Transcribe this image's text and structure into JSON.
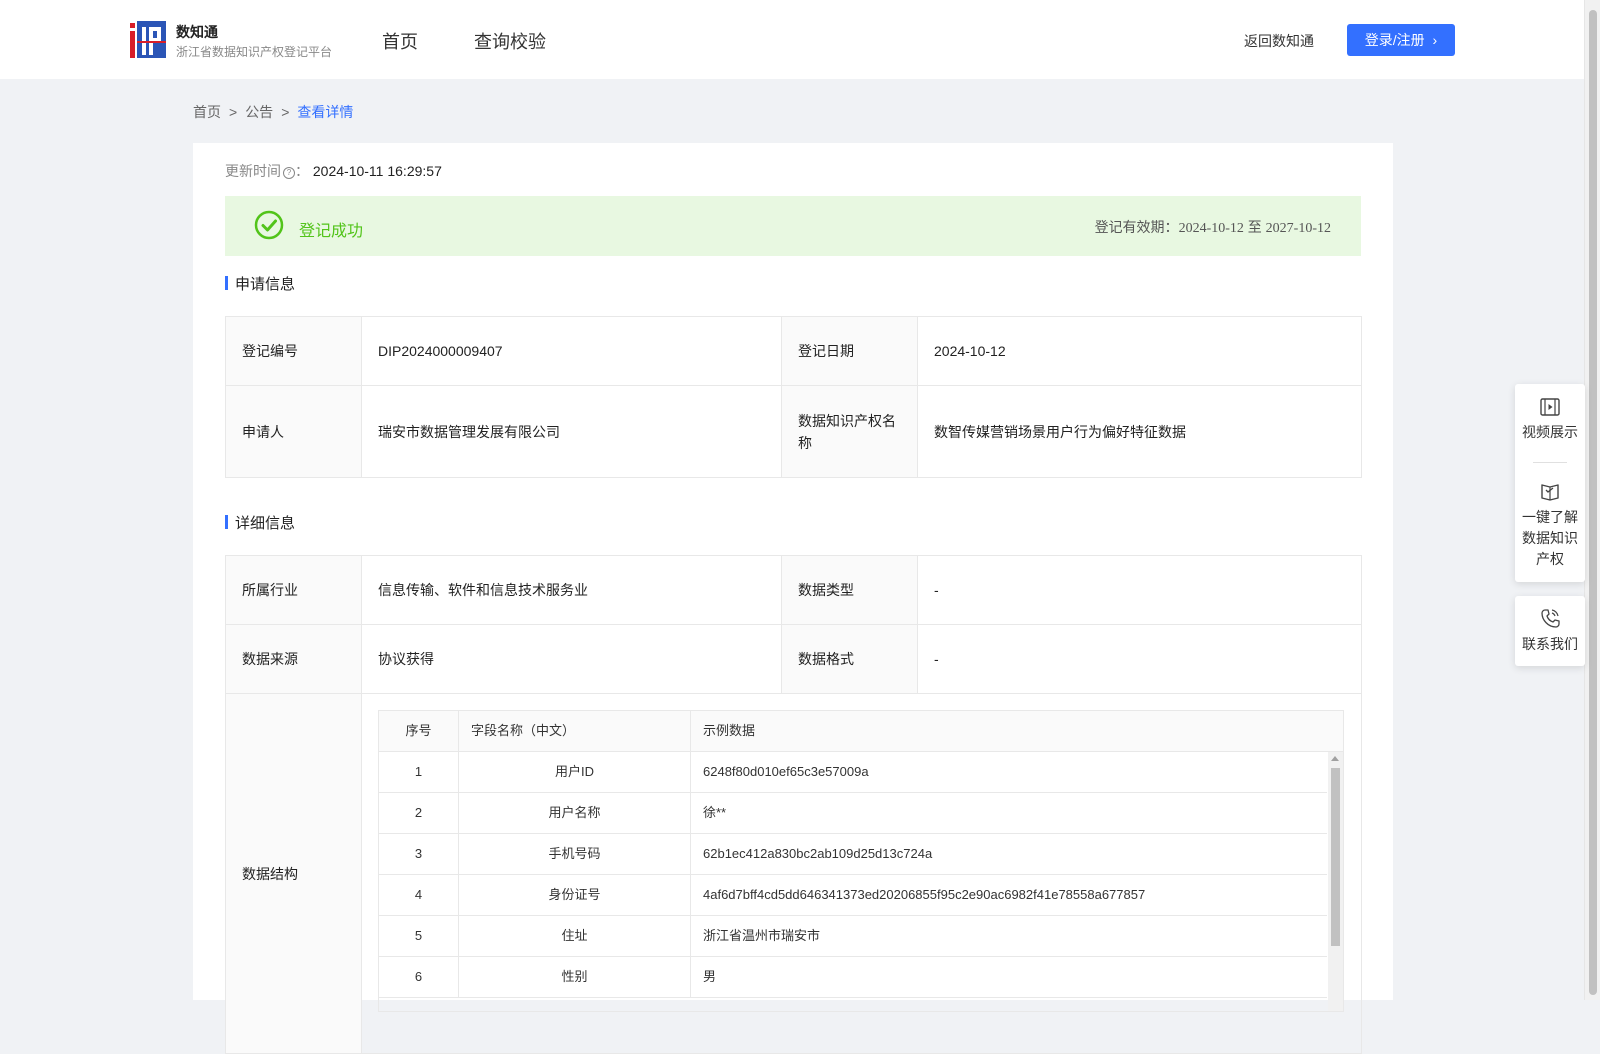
{
  "header": {
    "logo_text": "IP",
    "title": "数知通",
    "subtitle": "浙江省数据知识产权登记平台",
    "nav": [
      "首页",
      "查询校验"
    ],
    "back_link": "返回数知通",
    "login_button": "登录/注册"
  },
  "breadcrumb": {
    "home": "首页",
    "notice": "公告",
    "current": "查看详情",
    "separator": ">"
  },
  "update": {
    "label": "更新时间",
    "colon": "：",
    "value": "2024-10-11 16:29:57"
  },
  "status": {
    "label": "登记成功",
    "validity_label": "登记有效期：",
    "validity_start": "2024-10-12",
    "validity_to": "至",
    "validity_end": "2027-10-12",
    "color": "#52c41a"
  },
  "application_info": {
    "title": "申请信息",
    "reg_no_label": "登记编号",
    "reg_no": "DIP2024000009407",
    "reg_date_label": "登记日期",
    "reg_date": "2024-10-12",
    "applicant_label": "申请人",
    "applicant": "瑞安市数据管理发展有限公司",
    "ip_name_label": "数据知识产权名称",
    "ip_name": "数智传媒营销场景用户行为偏好特征数据"
  },
  "detail_info": {
    "title": "详细信息",
    "industry_label": "所属行业",
    "industry": "信息传输、软件和信息技术服务业",
    "data_type_label": "数据类型",
    "data_type": "-",
    "source_label": "数据来源",
    "source": "协议获得",
    "format_label": "数据格式",
    "format": "-",
    "structure_label": "数据结构"
  },
  "fields_table": {
    "headers": [
      "序号",
      "字段名称（中文）",
      "示例数据"
    ],
    "rows": [
      [
        "1",
        "用户ID",
        "6248f80d010ef65c3e57009a"
      ],
      [
        "2",
        "用户名称",
        "徐**"
      ],
      [
        "3",
        "手机号码",
        "62b1ec412a830bc2ab109d25d13c724a"
      ],
      [
        "4",
        "身份证号",
        "4af6d7bff4cd5dd646341373ed20206855f95c2e90ac6982f41e78558a677857"
      ],
      [
        "5",
        "住址",
        "浙江省温州市瑞安市"
      ],
      [
        "6",
        "性别",
        "男"
      ]
    ]
  },
  "side_panel": {
    "video": "视频展示",
    "learn": [
      "一键了解",
      "数据知识",
      "产权"
    ],
    "contact": "联系我们"
  },
  "colors": {
    "primary": "#3370ff",
    "success_bg": "#e8f8e1",
    "page_bg": "#f0f2f5"
  }
}
